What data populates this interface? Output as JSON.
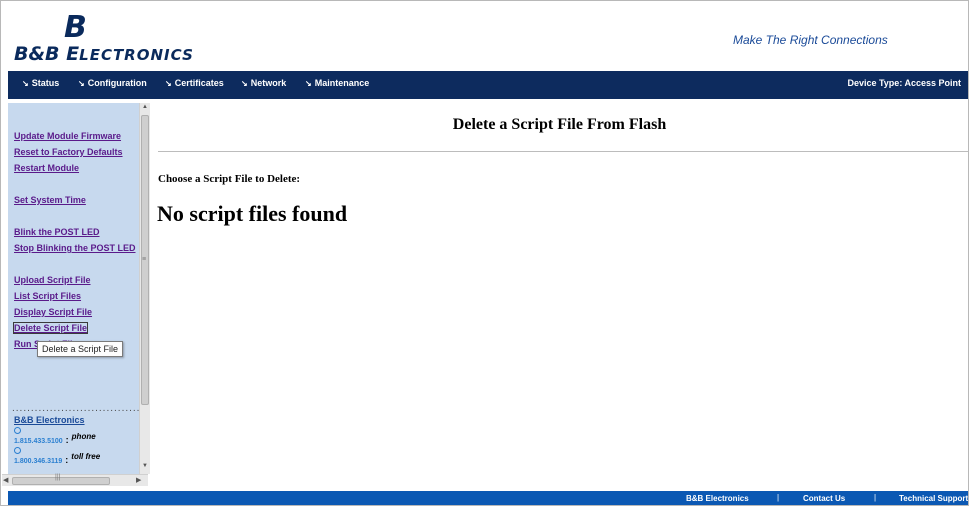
{
  "header": {
    "logo_mark": "B",
    "logo_initial": "B&B E",
    "logo_rest": "LECTRONICS",
    "tagline": "Make The Right Connections"
  },
  "nav": {
    "items": [
      "Status",
      "Configuration",
      "Certificates",
      "Network",
      "Maintenance"
    ],
    "chevron": "↘",
    "device_type": "Device Type: Access Point"
  },
  "sidebar": {
    "links": [
      "Update Module Firmware",
      "Reset to Factory Defaults",
      "Restart Module",
      "Set System Time",
      "Blink the POST LED",
      "Stop Blinking the POST LED",
      "Upload Script File",
      "List Script Files",
      "Display Script File",
      "Delete Script File",
      "Run Script File"
    ],
    "dots": "...................................",
    "company_link": "B&B Electronics",
    "phone_number": "1.815.433.5100",
    "phone_label": "phone",
    "tollfree_number": "1.800.346.3119",
    "tollfree_label": "toll free",
    "tooltip": "Delete a Script File"
  },
  "main": {
    "title": "Delete a Script File From Flash",
    "choose_label": "Choose a Script File to Delete:",
    "empty_message": "No script files found"
  },
  "footer": {
    "links": [
      "B&B Electronics",
      "Contact Us",
      "Technical Support"
    ],
    "separator": "|"
  },
  "colors": {
    "nav_bg": "#0d2b5e",
    "sidebar_bg": "#c7d9ee",
    "footer_bg": "#0b58b3",
    "link_visited": "#5a1a8a"
  }
}
